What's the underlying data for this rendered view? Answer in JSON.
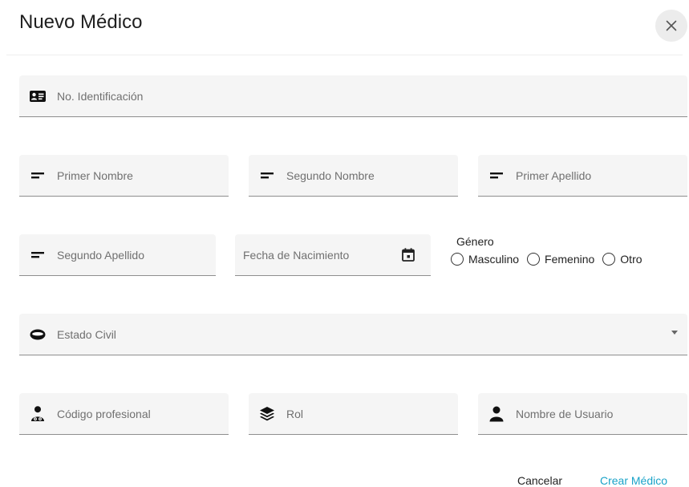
{
  "dialog": {
    "title": "Nuevo Médico",
    "close_icon": "close-icon"
  },
  "fields": {
    "identificacion": {
      "label": "No. Identificación",
      "icon": "id-card-icon"
    },
    "primer_nombre": {
      "label": "Primer Nombre",
      "icon": "short-text-icon"
    },
    "segundo_nombre": {
      "label": "Segundo Nombre",
      "icon": "short-text-icon"
    },
    "primer_apellido": {
      "label": "Primer Apellido",
      "icon": "short-text-icon"
    },
    "segundo_apellido": {
      "label": "Segundo Apellido",
      "icon": "short-text-icon"
    },
    "fecha_nacimiento": {
      "label": "Fecha de Nacimiento",
      "icon": "calendar-icon"
    },
    "estado_civil": {
      "label": "Estado Civil",
      "icon": "ring-icon"
    },
    "codigo_profesional": {
      "label": "Código profesional",
      "icon": "doctor-icon"
    },
    "rol": {
      "label": "Rol",
      "icon": "layers-icon"
    },
    "nombre_usuario": {
      "label": "Nombre de Usuario",
      "icon": "person-icon"
    }
  },
  "genero": {
    "label": "Género",
    "options": [
      "Masculino",
      "Femenino",
      "Otro"
    ]
  },
  "actions": {
    "cancel_label": "Cancelar",
    "create_label": "Crear Médico"
  },
  "colors": {
    "accent": "#1aa3c8",
    "field_bg": "#f5f5f5",
    "underline": "#8e8e8e"
  }
}
